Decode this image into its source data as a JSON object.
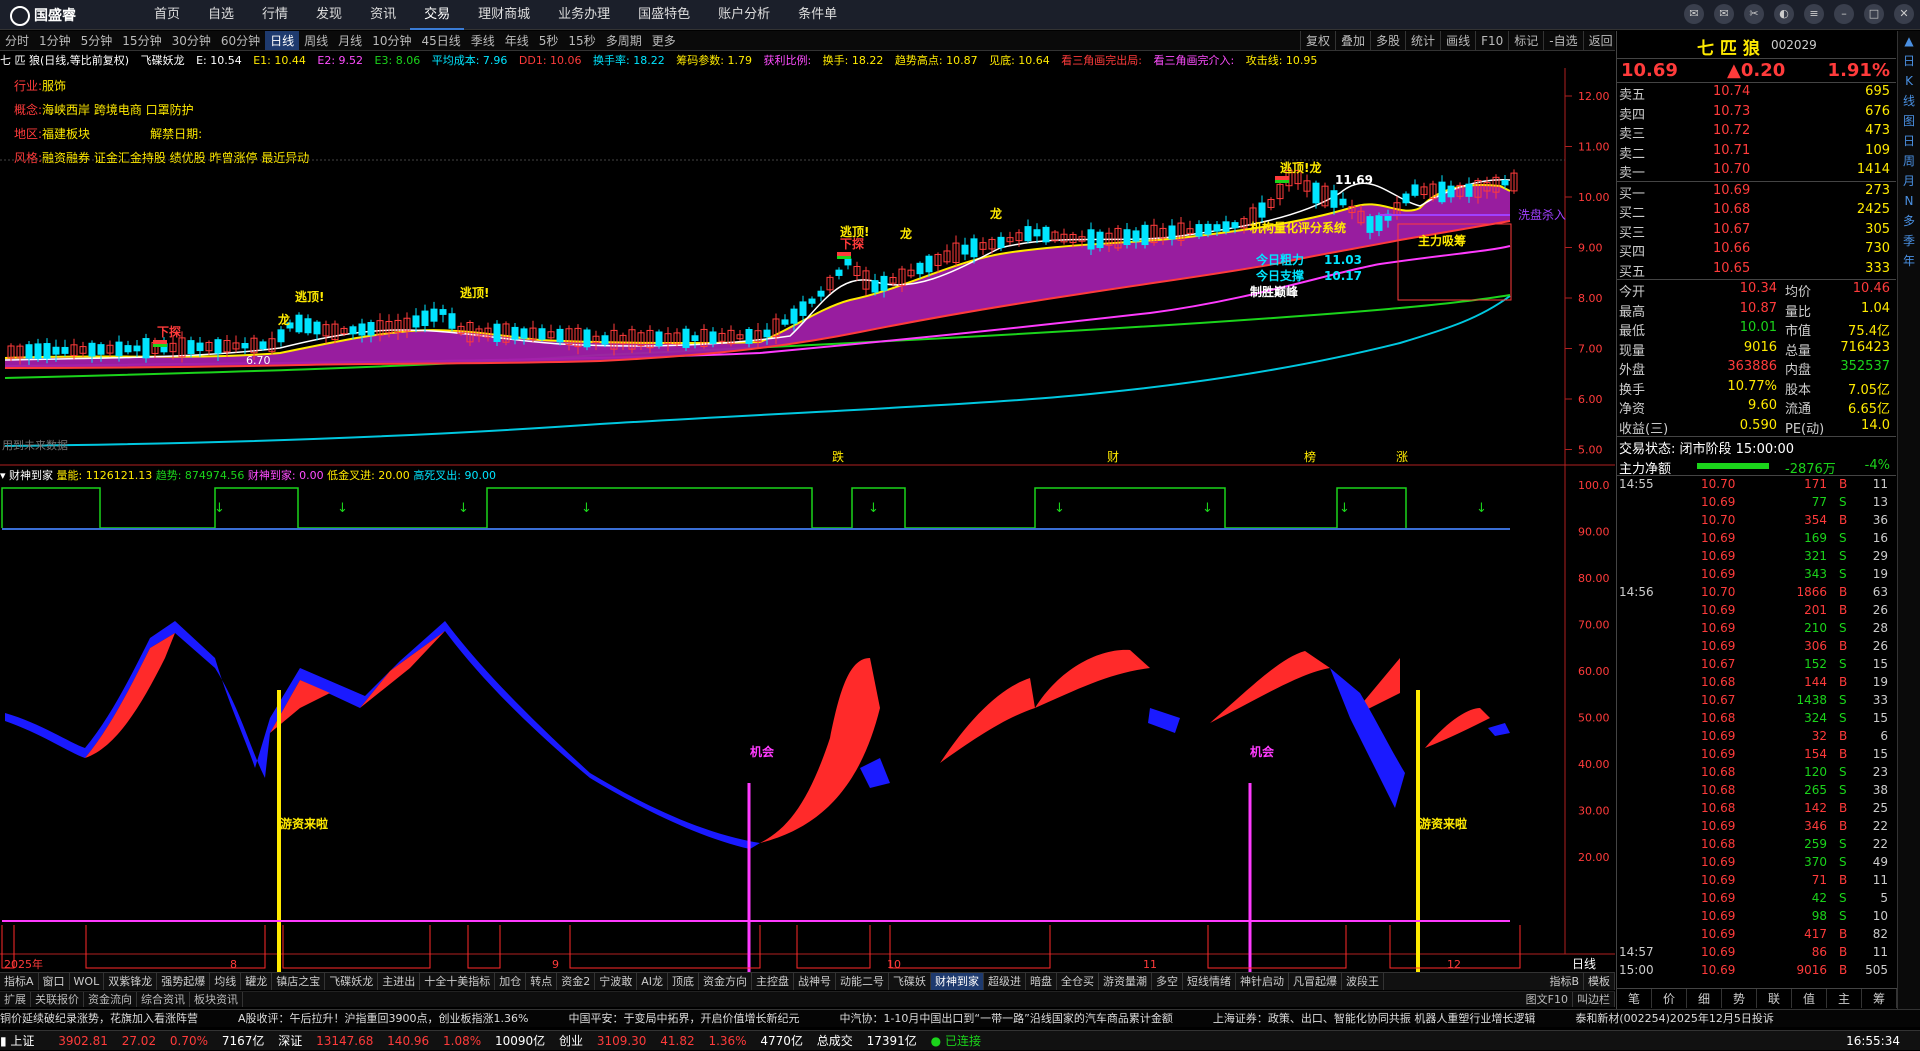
{
  "app": {
    "logo": "国盛睿"
  },
  "nav": [
    "首页",
    "自选",
    "行情",
    "发现",
    "资讯",
    "交易",
    "理财商城",
    "业务办理",
    "国盛特色",
    "账户分析",
    "条件单"
  ],
  "periods": [
    "分时",
    "1分钟",
    "5分钟",
    "15分钟",
    "30分钟",
    "60分钟",
    "日线",
    "周线",
    "月线",
    "10分钟",
    "45日线",
    "季线",
    "年线",
    "5秒",
    "15秒",
    "多周期",
    "更多"
  ],
  "tools": [
    "复权",
    "叠加",
    "多股",
    "统计",
    "画线",
    "F10",
    "标记",
    "-自选",
    "返回"
  ],
  "info": {
    "name": "七 匹 狼(日线,等比前复权)",
    "f1": "飞碟妖龙",
    "e": "E: 10.54",
    "e1": "E1: 10.44",
    "e2": "E2: 9.52",
    "e3": "E3: 8.06",
    "avgcost": "平均成本: 7.96",
    "dd1": "DD1: 10.06",
    "turn": "换手率: 18.22",
    "chip": "筹码参数: 1.79",
    "profit": "获利比例:",
    "hs": "换手: 18.22",
    "trend": "趋势高点: 10.87",
    "jian": "见底: 10.64",
    "tri": "看三角画完出局:",
    "tri2": "看三角画完介入:",
    "atk": "攻击线: 10.95"
  },
  "tags": {
    "industry_l": "行业:",
    "industry": "服饰",
    "concept_l": "概念:",
    "concept": "海峡西岸 跨境电商 口罩防护",
    "region_l": "地区:",
    "region": "福建板块",
    "unlock": "解禁日期:",
    "style_l": "风格:",
    "style": "融资融券 证金汇金持股 绩优股 昨曾涨停 最近异动"
  },
  "axis_main": [
    "12.00",
    "11.00",
    "10.00",
    "9.00",
    "8.00",
    "7.00",
    "6.00",
    "5.00"
  ],
  "axis_ind": [
    "100.0",
    "90.00",
    "80.00",
    "70.00",
    "60.00",
    "50.00",
    "40.00",
    "30.00",
    "20.00"
  ],
  "xlabels": [
    "2025年",
    "8",
    "9",
    "10",
    "11",
    "12"
  ],
  "annot": {
    "a1": "下探",
    "a2": "逃顶!",
    "a3": "逃顶!",
    "a4": "逃顶!",
    "a5": "下探",
    "a6": "逃顶!龙",
    "a7": "11.69",
    "a8": "机构量化评分系统",
    "a9": "今日粗力",
    "a10": "11.03",
    "a11": "今日支撑",
    "a12": "10.17",
    "a13": "制胜巅峰",
    "a14": "6.70",
    "a15": "洗盘杀入",
    "a16": "主力吸筹",
    "a17": "用到未来数据",
    "a18": "跌",
    "a19": "财",
    "a20": "榜",
    "a21": "涨",
    "a22": "龙",
    "a23": "龙",
    "a24": "龙"
  },
  "ind": {
    "name": "财神到家",
    "l1": "量能: 1126121.13",
    "l2": "趋势: 874974.56",
    "l3": "财神到家: 0.00",
    "l4": "低金叉进: 20.00",
    "l5": "高死叉出: 90.00",
    "cy1": "游资来啦",
    "cy2": "游资来啦",
    "jh1": "机会",
    "jh2": "机会"
  },
  "period_label": "日线",
  "btabs": [
    "指标A",
    "窗口",
    "WOL",
    "双紫锋龙",
    "强势起爆",
    "均线",
    "罐龙",
    "镇店之宝",
    "飞碟妖龙",
    "主进出",
    "十全十美指标",
    "加仓",
    "转点",
    "资金2",
    "宁波敢",
    "AI龙",
    "顶底",
    "资金方向",
    "主控盘",
    "战神号",
    "动能二号",
    "飞碟妖",
    "财神到家",
    "超级进",
    "暗盘",
    "全仓买",
    "游资量潮",
    "多空",
    "短线情绪",
    "神针启动",
    "凡冒起爆",
    "波段王"
  ],
  "btabs_r": [
    "指标B",
    "模板"
  ],
  "btabs2": [
    "扩展",
    "关联报价",
    "资金流向",
    "综合资讯",
    "板块资讯"
  ],
  "btabs2_r": [
    "图文F10",
    "叫边栏"
  ],
  "ticker": [
    "铜价延续破纪录涨势，花旗加入看涨阵营",
    "A股收评：午后拉升！沪指重回3900点，创业板指涨1.36%",
    "中国平安：于变局中拓界，开启价值增长新纪元",
    "中汽协：1-10月中国出口到“一带一路”沿线国家的汽车商品累计金额",
    "上海证券：政策、出口、智能化协同共振  机器人重塑行业增长逻辑",
    "泰和新材(002254)2025年12月5日投诉"
  ],
  "status": {
    "sh": "上证",
    "shv": "3902.81",
    "shc": "27.02",
    "shp": "0.70%",
    "sha": "7167亿",
    "sz": "深证",
    "szv": "13147.68",
    "szc": "140.96",
    "szp": "1.08%",
    "sza": "10090亿",
    "cy": "创业",
    "cyv": "3109.30",
    "cyc": "41.82",
    "cyp": "1.36%",
    "cya": "4770亿",
    "tot": "总成交",
    "tota": "17391亿",
    "conn": "已连接",
    "time": "16:55:34"
  },
  "quote": {
    "name": "七 匹 狼",
    "code": "002029",
    "price": "10.69",
    "chg": "▲0.20",
    "pct": "1.91%",
    "sell": [
      [
        "卖五",
        "10.74",
        "695"
      ],
      [
        "卖四",
        "10.73",
        "676"
      ],
      [
        "卖三",
        "10.72",
        "473"
      ],
      [
        "卖二",
        "10.71",
        "109"
      ],
      [
        "卖一",
        "10.70",
        "1414"
      ]
    ],
    "buy": [
      [
        "买一",
        "10.69",
        "273"
      ],
      [
        "买二",
        "10.68",
        "2425"
      ],
      [
        "买三",
        "10.67",
        "305"
      ],
      [
        "买四",
        "10.66",
        "730"
      ],
      [
        "买五",
        "10.65",
        "333"
      ]
    ],
    "stats": [
      [
        "今开",
        "10.34",
        "均价",
        "10.46"
      ],
      [
        "最高",
        "10.87",
        "量比",
        "1.04"
      ],
      [
        "最低",
        "10.01",
        "市值",
        "75.4亿"
      ],
      [
        "现量",
        "9016",
        "总量",
        "716423"
      ],
      [
        "外盘",
        "363886",
        "内盘",
        "352537"
      ],
      [
        "换手",
        "10.77%",
        "股本",
        "7.05亿"
      ],
      [
        "净资",
        "9.60",
        "流通",
        "6.65亿"
      ],
      [
        "收益(三)",
        "0.590",
        "PE(动)",
        "14.0"
      ]
    ],
    "state": "交易状态: 闭市阶段 15:00:00",
    "mainnet": "主力净额",
    "mainnet_v": "-2876万",
    "mainnet_p": "-4%",
    "ticks": [
      [
        "14:55",
        "10.70",
        "171",
        "B",
        "11"
      ],
      [
        "",
        "10.69",
        "77",
        "S",
        "13"
      ],
      [
        "",
        "10.70",
        "354",
        "B",
        "36"
      ],
      [
        "",
        "10.69",
        "169",
        "S",
        "16"
      ],
      [
        "",
        "10.69",
        "321",
        "S",
        "29"
      ],
      [
        "",
        "10.69",
        "343",
        "S",
        "19"
      ],
      [
        "14:56",
        "10.70",
        "1866",
        "B",
        "63"
      ],
      [
        "",
        "10.69",
        "201",
        "B",
        "26"
      ],
      [
        "",
        "10.69",
        "210",
        "S",
        "28"
      ],
      [
        "",
        "10.69",
        "306",
        "B",
        "26"
      ],
      [
        "",
        "10.67",
        "152",
        "S",
        "15"
      ],
      [
        "",
        "10.68",
        "144",
        "B",
        "19"
      ],
      [
        "",
        "10.67",
        "1438",
        "S",
        "33"
      ],
      [
        "",
        "10.68",
        "324",
        "S",
        "15"
      ],
      [
        "",
        "10.69",
        "32",
        "B",
        "6"
      ],
      [
        "",
        "10.69",
        "154",
        "B",
        "15"
      ],
      [
        "",
        "10.68",
        "120",
        "S",
        "23"
      ],
      [
        "",
        "10.68",
        "265",
        "S",
        "38"
      ],
      [
        "",
        "10.68",
        "142",
        "B",
        "25"
      ],
      [
        "",
        "10.69",
        "346",
        "B",
        "22"
      ],
      [
        "",
        "10.68",
        "259",
        "S",
        "22"
      ],
      [
        "",
        "10.69",
        "370",
        "S",
        "49"
      ],
      [
        "",
        "10.69",
        "71",
        "B",
        "11"
      ],
      [
        "",
        "10.69",
        "42",
        "S",
        "5"
      ],
      [
        "",
        "10.69",
        "98",
        "S",
        "10"
      ],
      [
        "",
        "10.69",
        "417",
        "B",
        "82"
      ],
      [
        "14:57",
        "10.69",
        "86",
        "B",
        "11"
      ],
      [
        "15:00",
        "10.69",
        "9016",
        "B",
        "505"
      ]
    ],
    "btabs": [
      "笔",
      "价",
      "细",
      "势",
      "联",
      "值",
      "主",
      "筹"
    ]
  },
  "side": [
    "日",
    "K",
    "线",
    "图",
    "日",
    "周",
    "月",
    "N",
    "多",
    "季",
    "年"
  ]
}
